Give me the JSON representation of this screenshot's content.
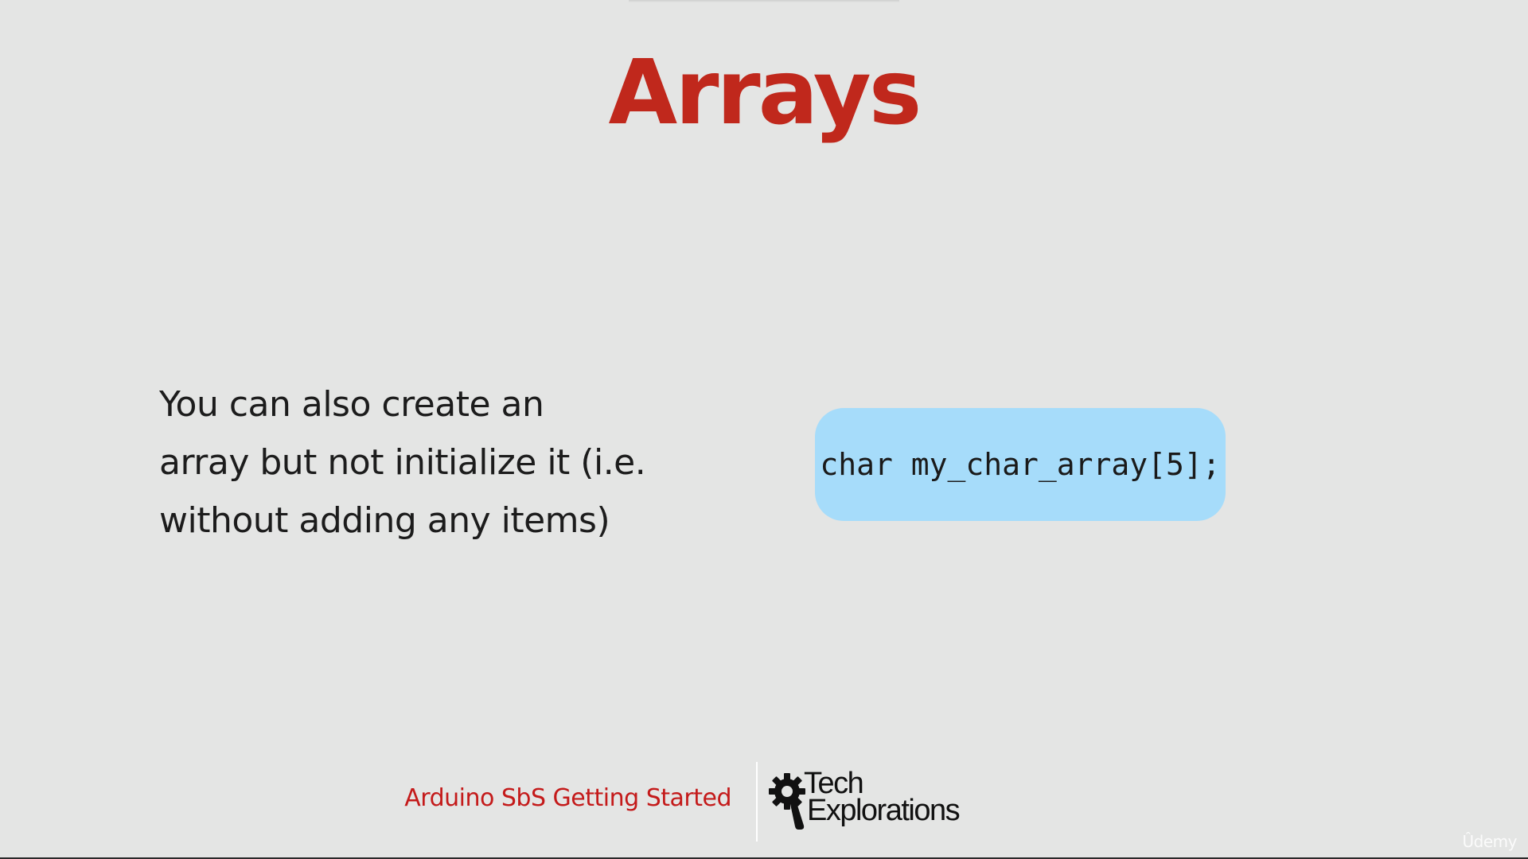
{
  "slide": {
    "title": "Arrays",
    "body_lines": [
      "You can also create an",
      "array but not initialize it (i.e.",
      "without adding any items)"
    ],
    "code": "char my_char_array[5];"
  },
  "footer": {
    "course_name": "Arduino SbS Getting Started",
    "logo_line1": "Tech",
    "logo_line2": "Explorations"
  },
  "watermark": "Ûdemy",
  "colors": {
    "background": "#e4e5e4",
    "title": "#c0281c",
    "code_box": "#a6dcfa",
    "course_name": "#c41a1a"
  },
  "icons": {
    "logo": "gear-magnifier-icon"
  }
}
